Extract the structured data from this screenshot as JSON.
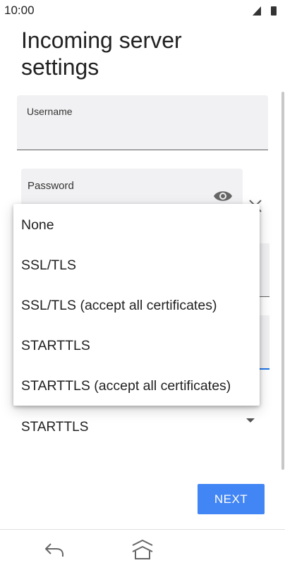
{
  "status_bar": {
    "time": "10:00",
    "icons": [
      "signal-icon",
      "battery-icon"
    ]
  },
  "page": {
    "title": "Incoming server settings"
  },
  "form": {
    "username_label": "Username",
    "password_label": "Password",
    "security_value": "STARTTLS"
  },
  "dropdown": {
    "options": [
      "None",
      "SSL/TLS",
      "SSL/TLS (accept all certificates)",
      "STARTTLS",
      "STARTTLS (accept all certificates)"
    ]
  },
  "actions": {
    "next_label": "NEXT"
  },
  "nav_bar": {
    "icons": [
      "back-icon",
      "home-icon"
    ]
  },
  "colors": {
    "accent": "#4285f4",
    "field_background": "#f1f1f3",
    "focus_underline": "#1a73e8"
  }
}
